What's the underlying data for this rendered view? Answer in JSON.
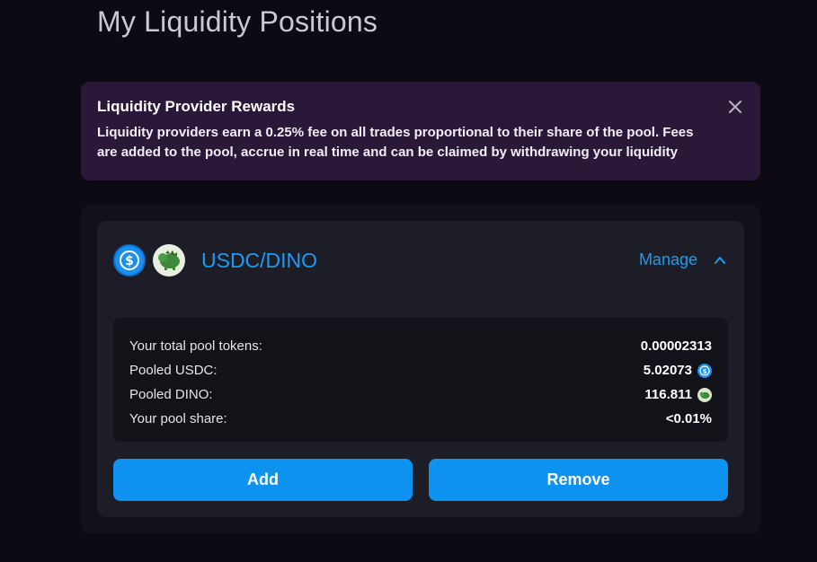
{
  "page": {
    "title": "My Liquidity Positions"
  },
  "rewards_banner": {
    "title": "Liquidity Provider Rewards",
    "text": "Liquidity providers earn a 0.25% fee on all trades proportional to their share of the pool. Fees are added to the pool, accrue in real time and can be claimed by withdrawing your liquidity",
    "close_icon": "close-icon"
  },
  "pool": {
    "pair_name": "USDC/DINO",
    "token_a_icon": "usdc-icon",
    "token_b_icon": "dino-icon",
    "manage_label": "Manage",
    "manage_icon": "chevron-up-icon",
    "stats": [
      {
        "label": "Your total pool tokens:",
        "value": "0.00002313",
        "icon": ""
      },
      {
        "label": "Pooled USDC:",
        "value": "5.02073",
        "icon": "usdc-icon"
      },
      {
        "label": "Pooled DINO:",
        "value": "116.811",
        "icon": "dino-icon"
      },
      {
        "label": "Your pool share:",
        "value": "<0.01%",
        "icon": ""
      }
    ],
    "add_label": "Add",
    "remove_label": "Remove"
  },
  "colors": {
    "background": "#0e0a14",
    "banner": "#2a1838",
    "accent": "#1d9bf0",
    "button": "#0d93ef"
  }
}
